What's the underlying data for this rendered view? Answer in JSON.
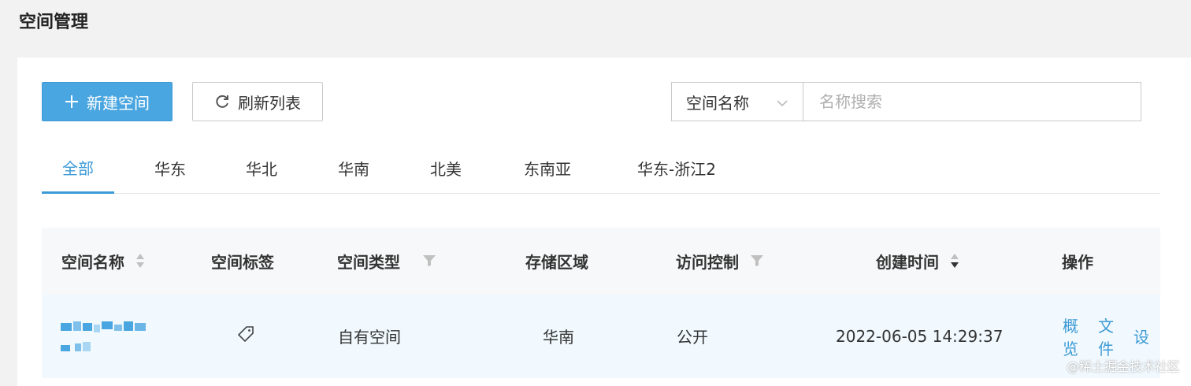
{
  "page": {
    "title": "空间管理"
  },
  "toolbar": {
    "new_label": "新建空间",
    "refresh_label": "刷新列表"
  },
  "search": {
    "field_selected": "空间名称",
    "placeholder": "名称搜索"
  },
  "tabs": [
    {
      "label": "全部",
      "active": true
    },
    {
      "label": "华东"
    },
    {
      "label": "华北"
    },
    {
      "label": "华南"
    },
    {
      "label": "北美"
    },
    {
      "label": "东南亚"
    },
    {
      "label": "华东-浙江2"
    }
  ],
  "table": {
    "headers": [
      "空间名称",
      "空间标签",
      "空间类型",
      "存储区域",
      "访问控制",
      "创建时间",
      "操作"
    ],
    "rows": [
      {
        "type": "自有空间",
        "region": "华南",
        "access": "公开",
        "created": "2022-06-05 14:29:37",
        "actions": [
          "概览",
          "文件",
          "设"
        ]
      }
    ]
  },
  "watermark": "@稀土掘金技术社区",
  "colors": {
    "accent": "#3d9ad6",
    "primary_button": "#4aa6e0",
    "row_highlight": "#f1f9fe"
  }
}
